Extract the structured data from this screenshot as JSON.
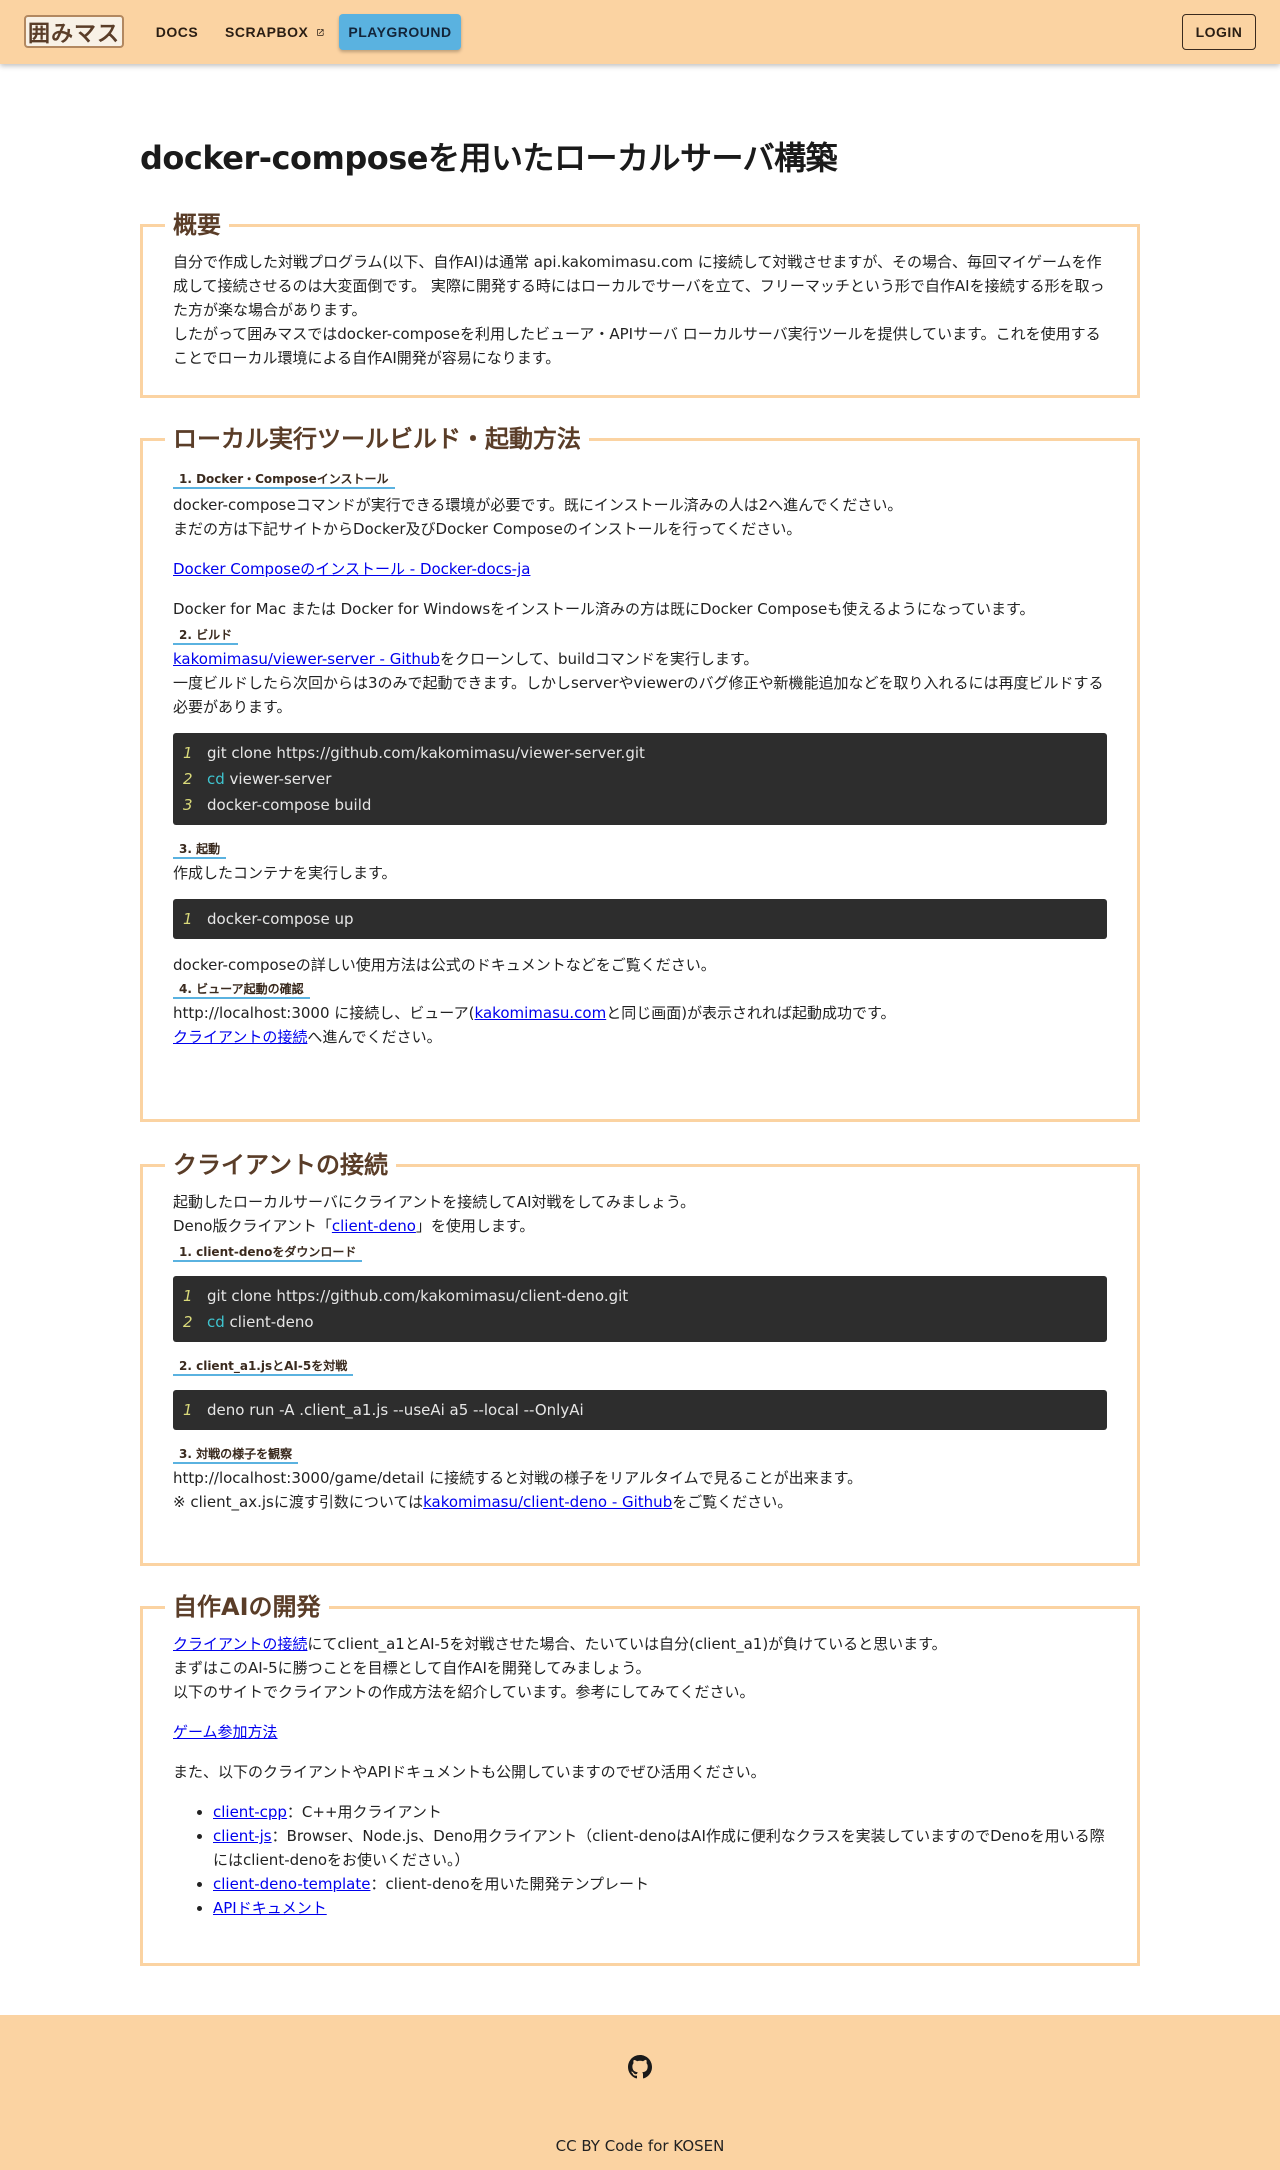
{
  "header": {
    "logo_text": "囲みマス",
    "nav": {
      "docs": "DOCS",
      "scrapbox": "SCRAPBOX",
      "playground": "PLAYGROUND",
      "login": "LOGIN"
    }
  },
  "page": {
    "title": "docker-composeを用いたローカルサーバ構築"
  },
  "overview": {
    "legend": "概要",
    "p1": "自分で作成した対戦プログラム(以下、自作AI)は通常 api.kakomimasu.com に接続して対戦させますが、その場合、毎回マイゲームを作成して接続させるのは大変面倒です。 実際に開発する時にはローカルでサーバを立て、フリーマッチという形で自作AIを接続する形を取った方が楽な場合があります。",
    "p2": "したがって囲みマスではdocker-composeを利用したビューア・APIサーバ ローカルサーバ実行ツールを提供しています。これを使用することでローカル環境による自作AI開発が容易になります。"
  },
  "build": {
    "legend": "ローカル実行ツールビルド・起動方法",
    "step1": {
      "heading": "1. Docker・Composeインストール",
      "line1": "docker-composeコマンドが実行できる環境が必要です。既にインストール済みの人は2へ進んでください。",
      "line2": "まだの方は下記サイトからDocker及びDocker Composeのインストールを行ってください。",
      "link": "Docker Composeのインストール - Docker-docs-ja",
      "note": "Docker for Mac または Docker for Windowsをインストール済みの方は既にDocker Composeも使えるようになっています。"
    },
    "step2": {
      "heading": "2. ビルド",
      "link": "kakomimasu/viewer-server - Github",
      "text1": "をクローンして、buildコマンドを実行します。",
      "text2": "一度ビルドしたら次回からは3のみで起動できます。しかしserverやviewerのバグ修正や新機能追加などを取り入れるには再度ビルドする必要があります。",
      "code": [
        {
          "n": "1",
          "kw": "",
          "t": "git clone https://github.com/kakomimasu/viewer-server.git"
        },
        {
          "n": "2",
          "kw": "cd",
          "t": " viewer-server"
        },
        {
          "n": "3",
          "kw": "",
          "t": "docker-compose build"
        }
      ]
    },
    "step3": {
      "heading": "3. 起動",
      "text": "作成したコンテナを実行します。",
      "code": [
        {
          "n": "1",
          "kw": "",
          "t": "docker-compose up"
        }
      ],
      "after": "docker-composeの詳しい使用方法は公式のドキュメントなどをご覧ください。"
    },
    "step4": {
      "heading": "4. ビューア起動の確認",
      "t1": "http://localhost:3000 に接続し、ビューア(",
      "link1": "kakomimasu.com",
      "t2": "と同じ画面)が表示されれば起動成功です。",
      "link2": "クライアントの接続",
      "t3": "へ進んでください。"
    }
  },
  "client": {
    "legend": "クライアントの接続",
    "line1": "起動したローカルサーバにクライアントを接続してAI対戦をしてみましょう。",
    "line2a": "Deno版クライアント「",
    "line2link": "client-deno",
    "line2b": "」を使用します。",
    "step1": {
      "heading": "1. client-denoをダウンロード",
      "code": [
        {
          "n": "1",
          "kw": "",
          "t": "git clone https://github.com/kakomimasu/client-deno.git"
        },
        {
          "n": "2",
          "kw": "cd",
          "t": " client-deno"
        }
      ]
    },
    "step2": {
      "heading": "2. client_a1.jsとAI-5を対戦",
      "code": [
        {
          "n": "1",
          "kw": "",
          "t": "deno run -A .client_a1.js --useAi a5 --local --OnlyAi"
        }
      ]
    },
    "step3": {
      "heading": "3. 対戦の様子を観察",
      "line1": "http://localhost:3000/game/detail に接続すると対戦の様子をリアルタイムで見ることが出来ます。",
      "line2a": "※ client_ax.jsに渡す引数については",
      "line2link": "kakomimasu/client-deno - Github",
      "line2b": "をご覧ください。"
    }
  },
  "dev": {
    "legend": "自作AIの開発",
    "link1": "クライアントの接続",
    "t1": "にてclient_a1とAI-5を対戦させた場合、たいていは自分(client_a1)が負けていると思います。",
    "t2": "まずはこのAI-5に勝つことを目標として自作AIを開発してみましょう。",
    "t3": "以下のサイトでクライアントの作成方法を紹介しています。参考にしてみてください。",
    "link2": "ゲーム参加方法",
    "t4": "また、以下のクライアントやAPIドキュメントも公開していますのでぜひ活用ください。",
    "resources": [
      {
        "link": "client-cpp",
        "desc": "：C++用クライアント"
      },
      {
        "link": "client-js",
        "desc": "：Browser、Node.js、Deno用クライアント（client-denoはAI作成に便利なクラスを実装していますのでDenoを用いる際にはclient-denoをお使いください。）"
      },
      {
        "link": "client-deno-template",
        "desc": "：client-denoを用いた開発テンプレート"
      },
      {
        "link": "APIドキュメント",
        "desc": ""
      }
    ]
  },
  "footer": {
    "text": "CC BY Code for KOSEN",
    "icon": "github-icon"
  },
  "colors": {
    "header_bg": "#fbd3a2",
    "accent_blue": "#5ab2e0",
    "legend_brown": "#5a3d28",
    "code_bg": "#2d2d2d"
  }
}
